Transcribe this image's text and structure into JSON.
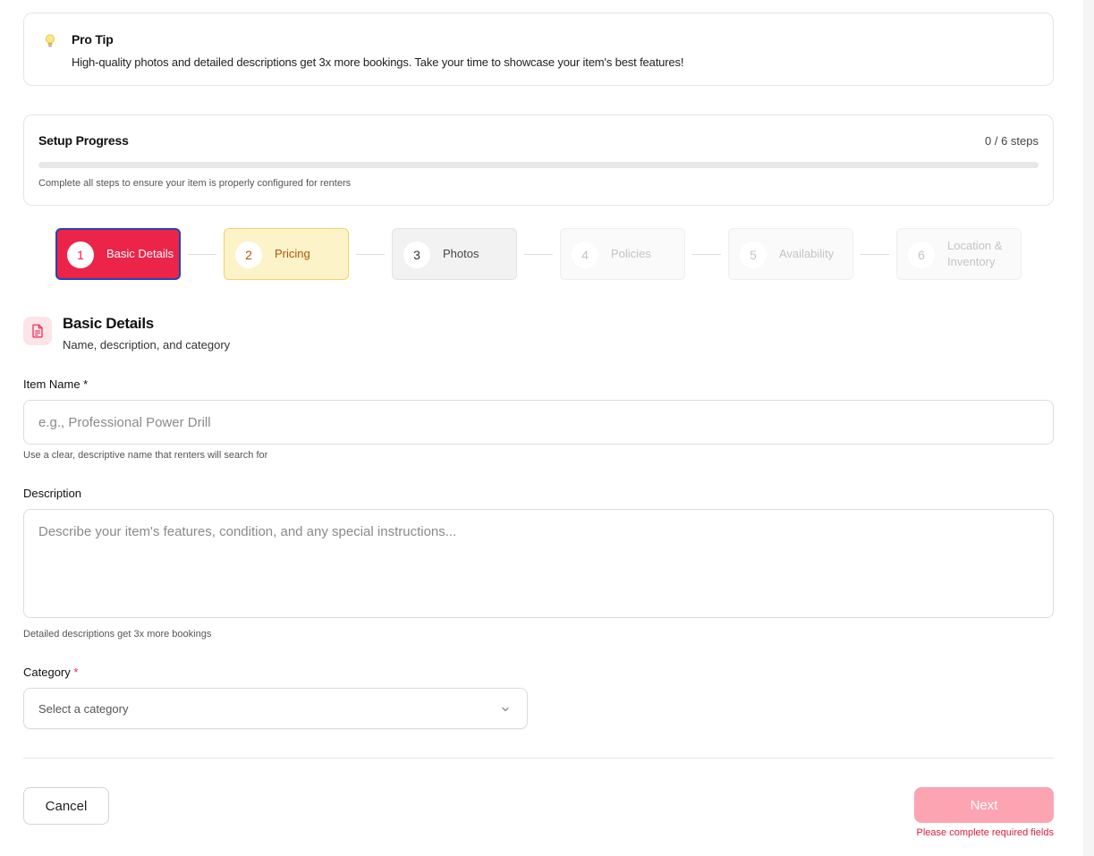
{
  "tip": {
    "icon": "lightbulb-icon",
    "title": "Pro Tip",
    "text": "High-quality photos and detailed descriptions get 3x more bookings. Take your time to showcase your item's best features!"
  },
  "progress": {
    "title": "Setup Progress",
    "count": "0 / 6 steps",
    "completed": 0,
    "total": 6,
    "note": "Complete all steps to ensure your item is properly configured for renters"
  },
  "steps": [
    {
      "number": "1",
      "label": "Basic Details",
      "state": "active"
    },
    {
      "number": "2",
      "label": "Pricing",
      "state": "next"
    },
    {
      "number": "3",
      "label": "Photos",
      "state": "upcoming"
    },
    {
      "number": "4",
      "label": "Policies",
      "state": "disabled"
    },
    {
      "number": "5",
      "label": "Availability",
      "state": "disabled"
    },
    {
      "number": "6",
      "label": "Location & Inventory",
      "state": "disabled"
    }
  ],
  "section": {
    "icon": "document-icon",
    "title": "Basic Details",
    "subtitle": "Name, description, and category"
  },
  "fields": {
    "item_name": {
      "label": "Item Name *",
      "value": "",
      "placeholder": "e.g., Professional Power Drill",
      "hint": "Use a clear, descriptive name that renters will search for"
    },
    "description": {
      "label": "Description",
      "value": "",
      "placeholder": "Describe your item's features, condition, and any special instructions...",
      "hint": "Detailed descriptions get 3x more bookings"
    },
    "category": {
      "label": "Category",
      "required_mark": "*",
      "selected": "Select a category"
    }
  },
  "actions": {
    "cancel_label": "Cancel",
    "next_label": "Next",
    "error": "Please complete required fields"
  },
  "colors": {
    "accent": "#ec2449",
    "accent_disabled": "#fda4b3",
    "step_next_bg": "#fdf3c8",
    "step_next_text": "#b45309",
    "error": "#dc1c3a"
  }
}
